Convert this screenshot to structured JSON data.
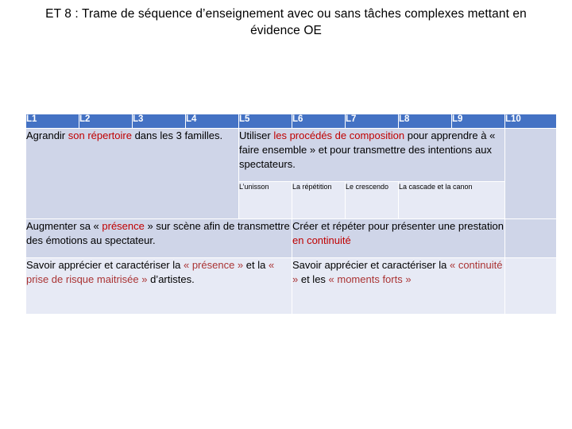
{
  "slide": {
    "title": "ET 8 : Trame de séquence d’enseignement avec ou sans tâches complexes mettant en évidence OE",
    "colors": {
      "header_blue": "#4472C4",
      "cell_blue_dark": "#CFD5E8",
      "cell_blue_light": "#E7EAF5",
      "accent_red": "#C00000",
      "text_black": "#000000"
    }
  },
  "table": {
    "headers": [
      "L1",
      "L2",
      "L3",
      "L4",
      "L5",
      "L6",
      "L7",
      "L8",
      "L9",
      "L10"
    ],
    "row1": {
      "left": {
        "part1": "Agrandir ",
        "part2": "son répertoire",
        "part3": "  dans les 3 familles."
      },
      "right": {
        "part1": "Utiliser ",
        "part2": "les procédés de composition",
        "part3": " pour apprendre à « faire ensemble » et pour transmettre des intentions aux spectateurs."
      }
    },
    "row2_sub": {
      "c1": "L’unisson",
      "c2": "La répétition",
      "c3": "Le crescendo",
      "c4": "La cascade et la canon"
    },
    "row3": {
      "left": {
        "part1": "Augmenter sa « ",
        "part2": "présence",
        "part3": " » sur scène afin de transmettre des émotions au spectateur."
      },
      "right": {
        "part1": "Créer et répéter pour présenter une prestation ",
        "part2": "en continuité",
        "part3": ""
      }
    },
    "row4": {
      "left": {
        "part1": "Savoir apprécier et caractériser la ",
        "part2": "« présence »",
        "part3": " et la ",
        "part4": "« prise de risque maitrisée »",
        "part5": " d’artistes."
      },
      "right": {
        "part1": "Savoir apprécier et caractériser la ",
        "part2": "« continuité »",
        "part3": " et les ",
        "part4": "« moments forts »",
        "part5": ""
      }
    }
  }
}
